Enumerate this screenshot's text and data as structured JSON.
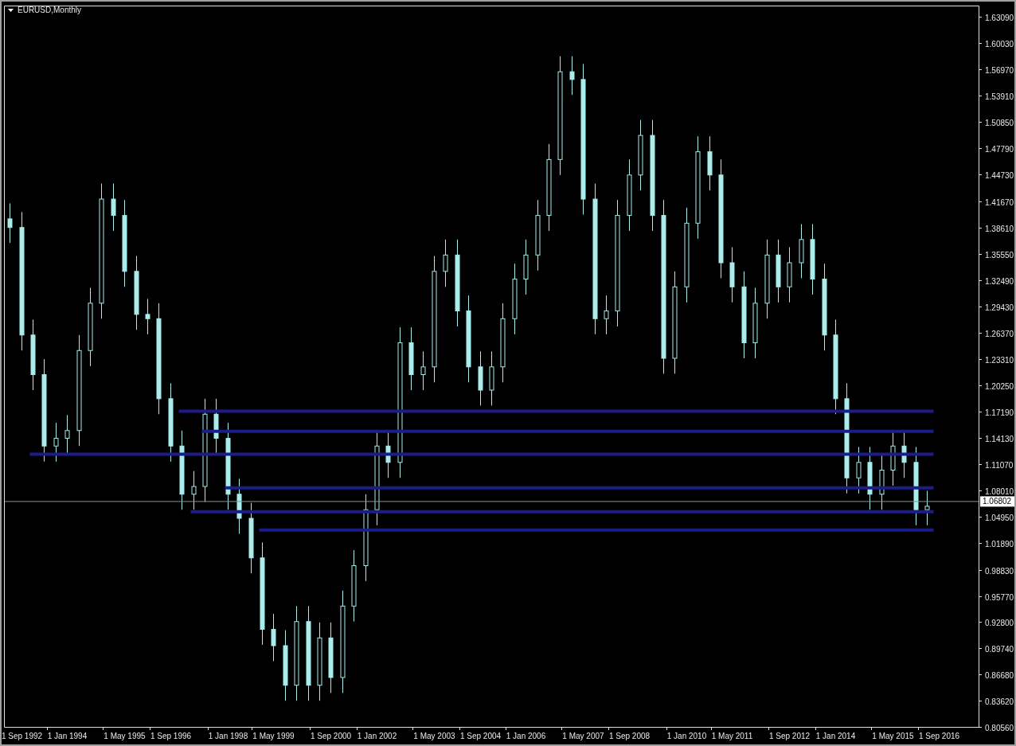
{
  "window": {
    "title": "EURUSD,Monthly"
  },
  "chart": {
    "chart_data": {
      "type": "candlestick",
      "ylim": [
        0.8056,
        1.6439
      ],
      "categories": [
        null,
        "1 Sep 1992",
        null,
        null,
        null,
        "1 Jan 1994",
        null,
        null,
        null,
        null,
        "1 May 1995",
        null,
        null,
        null,
        "1 Sep 1996",
        null,
        null,
        null,
        null,
        "1 Jan 1998",
        null,
        null,
        null,
        "1 May 1999",
        null,
        null,
        null,
        null,
        "1 Sep 2000",
        null,
        null,
        null,
        "1 Jan 2002",
        null,
        null,
        null,
        null,
        "1 May 2003",
        null,
        null,
        null,
        "1 Sep 2004",
        null,
        null,
        null,
        "1 Jan 2006",
        null,
        null,
        null,
        null,
        "1 May 2007",
        null,
        null,
        null,
        "1 Sep 2008",
        null,
        null,
        null,
        null,
        "1 Jan 2010",
        null,
        null,
        null,
        "1 May 2011",
        null,
        null,
        null,
        null,
        "1 Sep 2012",
        null,
        null,
        null,
        "1 Jan 2014",
        null,
        null,
        null,
        null,
        "1 May 2015",
        null,
        null,
        null,
        "1 Sep 2016",
        null,
        null,
        null
      ],
      "ohlc": [
        [
          1.396,
          1.414,
          1.368,
          1.386
        ],
        [
          1.386,
          1.404,
          1.243,
          1.261
        ],
        [
          1.261,
          1.279,
          1.197,
          1.215
        ],
        [
          1.215,
          1.233,
          1.114,
          1.132
        ],
        [
          1.132,
          1.159,
          1.114,
          1.141
        ],
        [
          1.141,
          1.168,
          1.123,
          1.15
        ],
        [
          1.15,
          1.261,
          1.132,
          1.243
        ],
        [
          1.243,
          1.316,
          1.225,
          1.298
        ],
        [
          1.298,
          1.437,
          1.28,
          1.419
        ],
        [
          1.419,
          1.437,
          1.382,
          1.4
        ],
        [
          1.4,
          1.418,
          1.317,
          1.335
        ],
        [
          1.335,
          1.353,
          1.267,
          1.285
        ],
        [
          1.285,
          1.303,
          1.262,
          1.28
        ],
        [
          1.28,
          1.298,
          1.169,
          1.187
        ],
        [
          1.187,
          1.205,
          1.114,
          1.132
        ],
        [
          1.132,
          1.15,
          1.058,
          1.076
        ],
        [
          1.076,
          1.103,
          1.058,
          1.085
        ],
        [
          1.085,
          1.187,
          1.067,
          1.169
        ],
        [
          1.169,
          1.187,
          1.123,
          1.141
        ],
        [
          1.141,
          1.159,
          1.058,
          1.076
        ],
        [
          1.076,
          1.094,
          1.03,
          1.048
        ],
        [
          1.048,
          1.066,
          0.984,
          1.002
        ],
        [
          1.002,
          1.02,
          0.901,
          0.919
        ],
        [
          0.919,
          0.937,
          0.882,
          0.9
        ],
        [
          0.9,
          0.918,
          0.836,
          0.854
        ],
        [
          0.854,
          0.946,
          0.836,
          0.928
        ],
        [
          0.928,
          0.946,
          0.836,
          0.854
        ],
        [
          0.854,
          0.927,
          0.836,
          0.909
        ],
        [
          0.909,
          0.927,
          0.845,
          0.863
        ],
        [
          0.863,
          0.964,
          0.845,
          0.946
        ],
        [
          0.946,
          1.011,
          0.928,
          0.993
        ],
        [
          0.993,
          1.076,
          0.975,
          1.058
        ],
        [
          1.058,
          1.15,
          1.04,
          1.132
        ],
        [
          1.132,
          1.15,
          1.095,
          1.113
        ],
        [
          1.113,
          1.27,
          1.095,
          1.252
        ],
        [
          1.252,
          1.27,
          1.197,
          1.215
        ],
        [
          1.215,
          1.242,
          1.197,
          1.224
        ],
        [
          1.224,
          1.353,
          1.206,
          1.335
        ],
        [
          1.335,
          1.372,
          1.317,
          1.354
        ],
        [
          1.354,
          1.372,
          1.271,
          1.289
        ],
        [
          1.289,
          1.307,
          1.206,
          1.224
        ],
        [
          1.224,
          1.242,
          1.179,
          1.197
        ],
        [
          1.197,
          1.242,
          1.179,
          1.224
        ],
        [
          1.224,
          1.298,
          1.206,
          1.28
        ],
        [
          1.28,
          1.344,
          1.262,
          1.326
        ],
        [
          1.326,
          1.372,
          1.308,
          1.354
        ],
        [
          1.354,
          1.418,
          1.336,
          1.4
        ],
        [
          1.4,
          1.483,
          1.382,
          1.465
        ],
        [
          1.465,
          1.585,
          1.447,
          1.567
        ],
        [
          1.567,
          1.585,
          1.54,
          1.558
        ],
        [
          1.558,
          1.576,
          1.401,
          1.419
        ],
        [
          1.419,
          1.437,
          1.262,
          1.28
        ],
        [
          1.28,
          1.307,
          1.262,
          1.289
        ],
        [
          1.289,
          1.418,
          1.271,
          1.4
        ],
        [
          1.4,
          1.465,
          1.382,
          1.447
        ],
        [
          1.447,
          1.511,
          1.429,
          1.493
        ],
        [
          1.493,
          1.511,
          1.382,
          1.4
        ],
        [
          1.4,
          1.418,
          1.216,
          1.234
        ],
        [
          1.234,
          1.335,
          1.216,
          1.317
        ],
        [
          1.317,
          1.409,
          1.299,
          1.391
        ],
        [
          1.391,
          1.492,
          1.373,
          1.474
        ],
        [
          1.474,
          1.492,
          1.429,
          1.447
        ],
        [
          1.447,
          1.465,
          1.327,
          1.345
        ],
        [
          1.345,
          1.363,
          1.299,
          1.317
        ],
        [
          1.317,
          1.335,
          1.234,
          1.252
        ],
        [
          1.252,
          1.316,
          1.234,
          1.298
        ],
        [
          1.298,
          1.372,
          1.28,
          1.354
        ],
        [
          1.354,
          1.372,
          1.299,
          1.317
        ],
        [
          1.317,
          1.363,
          1.299,
          1.345
        ],
        [
          1.345,
          1.39,
          1.327,
          1.372
        ],
        [
          1.372,
          1.39,
          1.308,
          1.326
        ],
        [
          1.326,
          1.344,
          1.243,
          1.261
        ],
        [
          1.261,
          1.279,
          1.169,
          1.187
        ],
        [
          1.187,
          1.205,
          1.077,
          1.095
        ],
        [
          1.095,
          1.131,
          1.077,
          1.113
        ],
        [
          1.113,
          1.131,
          1.058,
          1.076
        ],
        [
          1.076,
          1.122,
          1.058,
          1.104
        ],
        [
          1.104,
          1.15,
          1.086,
          1.132
        ],
        [
          1.132,
          1.15,
          1.095,
          1.113
        ],
        [
          1.113,
          1.131,
          1.04,
          1.058
        ],
        [
          1.058,
          1.08,
          1.04,
          1.062
        ],
        null,
        null,
        null,
        null
      ],
      "yticks": [
        {
          "value": 1.6309,
          "label": "1.63090"
        },
        {
          "value": 1.6003,
          "label": "1.60030"
        },
        {
          "value": 1.5697,
          "label": "1.56970"
        },
        {
          "value": 1.5391,
          "label": "1.53910"
        },
        {
          "value": 1.5085,
          "label": "1.50850"
        },
        {
          "value": 1.4779,
          "label": "1.47790"
        },
        {
          "value": 1.4473,
          "label": "1.44730"
        },
        {
          "value": 1.4167,
          "label": "1.41670"
        },
        {
          "value": 1.3861,
          "label": "1.38610"
        },
        {
          "value": 1.3555,
          "label": "1.35550"
        },
        {
          "value": 1.3249,
          "label": "1.32490"
        },
        {
          "value": 1.2943,
          "label": "1.29430"
        },
        {
          "value": 1.2637,
          "label": "1.26370"
        },
        {
          "value": 1.2331,
          "label": "1.23310"
        },
        {
          "value": 1.2025,
          "label": "1.20250"
        },
        {
          "value": 1.1719,
          "label": "1.17190"
        },
        {
          "value": 1.1413,
          "label": "1.14130"
        },
        {
          "value": 1.1107,
          "label": "1.11070"
        },
        {
          "value": 1.0801,
          "label": "1.08010"
        },
        {
          "value": 1.0495,
          "label": "1.04950"
        },
        {
          "value": 1.0189,
          "label": "1.01890"
        },
        {
          "value": 0.9883,
          "label": "0.98830"
        },
        {
          "value": 0.9577,
          "label": "0.95770"
        },
        {
          "value": 0.928,
          "label": "0.92800"
        },
        {
          "value": 0.8974,
          "label": "0.89740"
        },
        {
          "value": 0.8668,
          "label": "0.86680"
        },
        {
          "value": 0.8362,
          "label": "0.83620"
        },
        {
          "value": 0.8056,
          "label": "0.80560"
        }
      ],
      "ref_lines": [
        {
          "axis": "y",
          "value": 1.1724,
          "color": "#1c1c8a"
        },
        {
          "axis": "y",
          "value": 1.1492,
          "color": "#1c1c8a"
        },
        {
          "axis": "y",
          "value": 1.1224,
          "color": "#1c1c8a"
        },
        {
          "axis": "y",
          "value": 1.0835,
          "color": "#1c1c8a"
        },
        {
          "axis": "y",
          "value": 1.0557,
          "color": "#1c1c8a"
        },
        {
          "axis": "y",
          "value": 1.0344,
          "color": "#1c1c8a"
        },
        {
          "axis": "y",
          "value": 1.06802,
          "label": "1.06802",
          "color": "#7f94a8"
        }
      ]
    }
  }
}
